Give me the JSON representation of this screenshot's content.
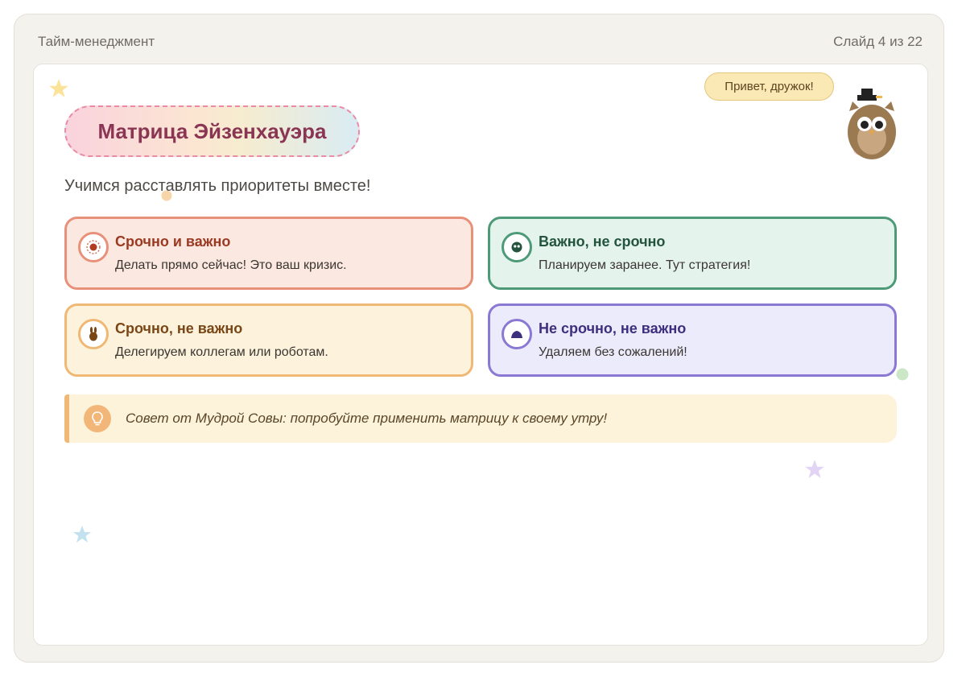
{
  "topbar": {
    "title": "Тайм-менеджмент",
    "slide_counter": "Слайд 4 из 22"
  },
  "slide": {
    "title": "Матрица Эйзенхауэра",
    "subtitle": "Учимся расставлять приоритеты вместе!",
    "greeting": "Привет, дружок!",
    "quadrants": [
      {
        "title": "Срочно и важно",
        "description": "Делать прямо сейчас! Это ваш кризис.",
        "icon": "fire-icon"
      },
      {
        "title": "Важно, не срочно",
        "description": "Планируем заранее. Тут стратегия!",
        "icon": "owl-face-icon"
      },
      {
        "title": "Срочно, не важно",
        "description": "Делегируем коллегам или роботам.",
        "icon": "bunny-icon"
      },
      {
        "title": "Не срочно, не важно",
        "description": "Удаляем без сожалений!",
        "icon": "trash-pile-icon"
      }
    ],
    "tip": {
      "text": "Совет от Мудрой Совы: попробуйте применить матрицу к своему утру!",
      "icon": "lightbulb-icon"
    }
  },
  "colors": {
    "urgent_important": "#e8917a",
    "important_not_urgent": "#4e9a78",
    "urgent_not_important": "#efb874",
    "not_urgent_not_important": "#8a78d2",
    "title_text": "#8b3554"
  }
}
